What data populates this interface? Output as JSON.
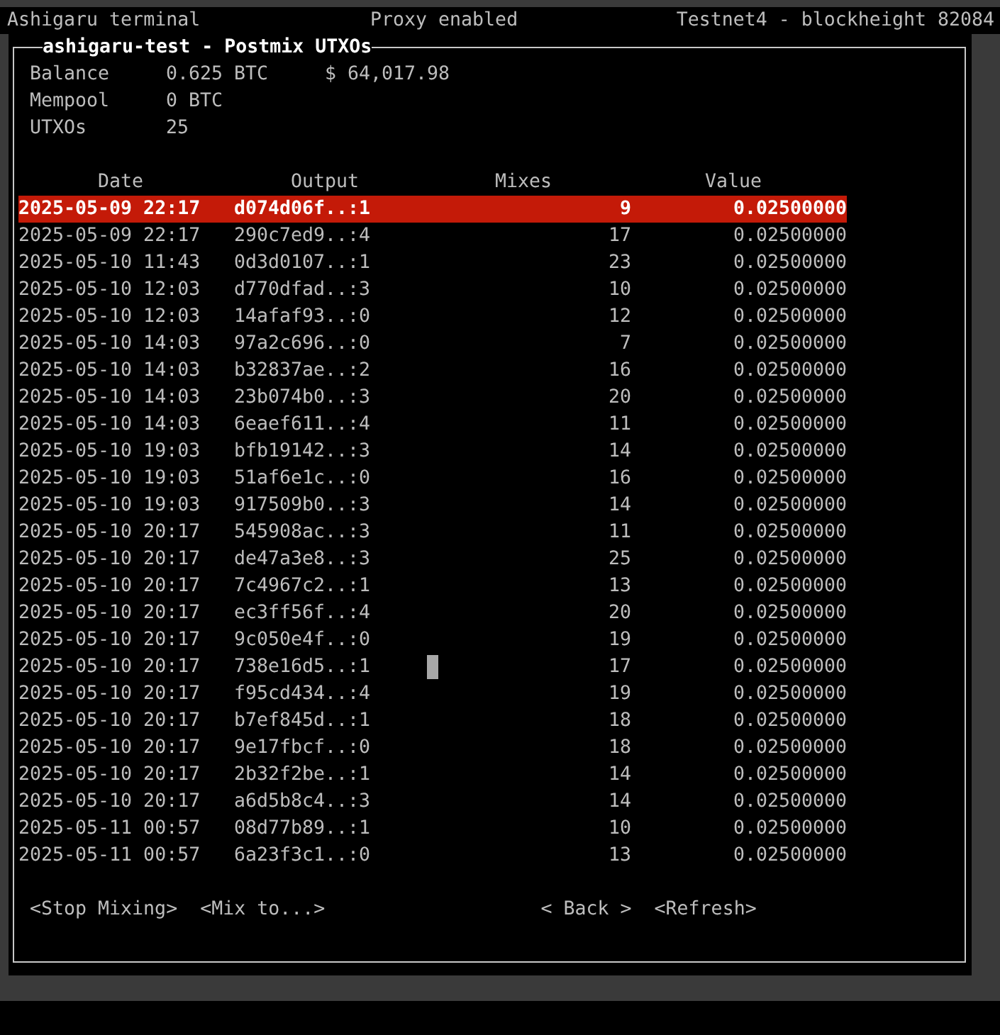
{
  "top_bar": {
    "app_name": "Ashigaru terminal",
    "proxy_status": "Proxy enabled",
    "network": "Testnet4 - blockheight 82084"
  },
  "panel": {
    "title": "ashigaru-test - Postmix UTXOs",
    "summary": [
      {
        "label": "Balance",
        "value": "0.625 BTC",
        "fiat": "$ 64,017.98"
      },
      {
        "label": "Mempool",
        "value": "0 BTC"
      },
      {
        "label": "UTXOs",
        "value": "25"
      }
    ],
    "table": {
      "columns": [
        "Date",
        "Output",
        "Mixes",
        "Value"
      ],
      "rows": [
        {
          "date": "2025-05-09 22:17",
          "output": "d074d06f..:1",
          "mixes": "9",
          "value": "0.02500000",
          "selected": true,
          "cursor": false
        },
        {
          "date": "2025-05-09 22:17",
          "output": "290c7ed9..:4",
          "mixes": "17",
          "value": "0.02500000",
          "selected": false,
          "cursor": false
        },
        {
          "date": "2025-05-10 11:43",
          "output": "0d3d0107..:1",
          "mixes": "23",
          "value": "0.02500000",
          "selected": false,
          "cursor": false
        },
        {
          "date": "2025-05-10 12:03",
          "output": "d770dfad..:3",
          "mixes": "10",
          "value": "0.02500000",
          "selected": false,
          "cursor": false
        },
        {
          "date": "2025-05-10 12:03",
          "output": "14afaf93..:0",
          "mixes": "12",
          "value": "0.02500000",
          "selected": false,
          "cursor": false
        },
        {
          "date": "2025-05-10 14:03",
          "output": "97a2c696..:0",
          "mixes": "7",
          "value": "0.02500000",
          "selected": false,
          "cursor": false
        },
        {
          "date": "2025-05-10 14:03",
          "output": "b32837ae..:2",
          "mixes": "16",
          "value": "0.02500000",
          "selected": false,
          "cursor": false
        },
        {
          "date": "2025-05-10 14:03",
          "output": "23b074b0..:3",
          "mixes": "20",
          "value": "0.02500000",
          "selected": false,
          "cursor": false
        },
        {
          "date": "2025-05-10 14:03",
          "output": "6eaef611..:4",
          "mixes": "11",
          "value": "0.02500000",
          "selected": false,
          "cursor": false
        },
        {
          "date": "2025-05-10 19:03",
          "output": "bfb19142..:3",
          "mixes": "14",
          "value": "0.02500000",
          "selected": false,
          "cursor": false
        },
        {
          "date": "2025-05-10 19:03",
          "output": "51af6e1c..:0",
          "mixes": "16",
          "value": "0.02500000",
          "selected": false,
          "cursor": false
        },
        {
          "date": "2025-05-10 19:03",
          "output": "917509b0..:3",
          "mixes": "14",
          "value": "0.02500000",
          "selected": false,
          "cursor": false
        },
        {
          "date": "2025-05-10 20:17",
          "output": "545908ac..:3",
          "mixes": "11",
          "value": "0.02500000",
          "selected": false,
          "cursor": false
        },
        {
          "date": "2025-05-10 20:17",
          "output": "de47a3e8..:3",
          "mixes": "25",
          "value": "0.02500000",
          "selected": false,
          "cursor": false
        },
        {
          "date": "2025-05-10 20:17",
          "output": "7c4967c2..:1",
          "mixes": "13",
          "value": "0.02500000",
          "selected": false,
          "cursor": false
        },
        {
          "date": "2025-05-10 20:17",
          "output": "ec3ff56f..:4",
          "mixes": "20",
          "value": "0.02500000",
          "selected": false,
          "cursor": false
        },
        {
          "date": "2025-05-10 20:17",
          "output": "9c050e4f..:0",
          "mixes": "19",
          "value": "0.02500000",
          "selected": false,
          "cursor": false
        },
        {
          "date": "2025-05-10 20:17",
          "output": "738e16d5..:1",
          "mixes": "17",
          "value": "0.02500000",
          "selected": false,
          "cursor": true
        },
        {
          "date": "2025-05-10 20:17",
          "output": "f95cd434..:4",
          "mixes": "19",
          "value": "0.02500000",
          "selected": false,
          "cursor": false
        },
        {
          "date": "2025-05-10 20:17",
          "output": "b7ef845d..:1",
          "mixes": "18",
          "value": "0.02500000",
          "selected": false,
          "cursor": false
        },
        {
          "date": "2025-05-10 20:17",
          "output": "9e17fbcf..:0",
          "mixes": "18",
          "value": "0.02500000",
          "selected": false,
          "cursor": false
        },
        {
          "date": "2025-05-10 20:17",
          "output": "2b32f2be..:1",
          "mixes": "14",
          "value": "0.02500000",
          "selected": false,
          "cursor": false
        },
        {
          "date": "2025-05-10 20:17",
          "output": "a6d5b8c4..:3",
          "mixes": "14",
          "value": "0.02500000",
          "selected": false,
          "cursor": false
        },
        {
          "date": "2025-05-11 00:57",
          "output": "08d77b89..:1",
          "mixes": "10",
          "value": "0.02500000",
          "selected": false,
          "cursor": false
        },
        {
          "date": "2025-05-11 00:57",
          "output": "6a23f3c1..:0",
          "mixes": "13",
          "value": "0.02500000",
          "selected": false,
          "cursor": false
        }
      ]
    },
    "buttons": [
      "<Stop Mixing>",
      "<Mix to...>",
      "< Back >",
      "<Refresh>"
    ]
  }
}
